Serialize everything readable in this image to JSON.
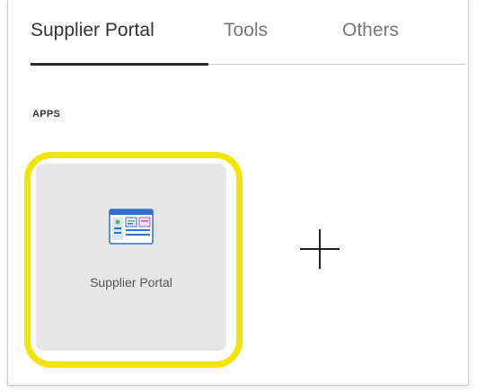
{
  "tabs": [
    {
      "label": "Supplier Portal",
      "active": true
    },
    {
      "label": "Tools",
      "active": false
    },
    {
      "label": "Others",
      "active": false
    }
  ],
  "apps_section": {
    "label": "APPS"
  },
  "apps": [
    {
      "label": "Supplier Portal",
      "icon": "app-window-icon"
    }
  ],
  "add_button": {
    "icon": "plus-icon"
  },
  "colors": {
    "highlight": "#f2e600",
    "tile_background": "#e6e6e6",
    "icon_blue": "#2f6fd1",
    "icon_green": "#5cb85c",
    "active_tab_underline": "#2b2b2b"
  }
}
